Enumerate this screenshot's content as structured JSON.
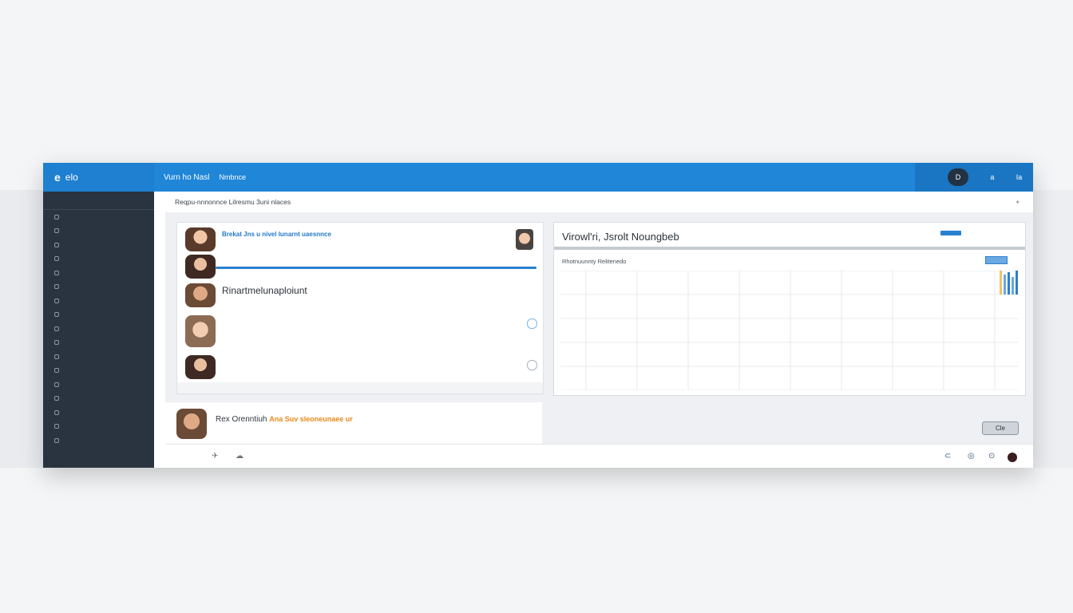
{
  "sidebar": {
    "logo": "e",
    "brand": "elo",
    "subnav": [
      "",
      ""
    ],
    "items": [
      {
        "label": "",
        "badge": ""
      },
      {
        "label": "",
        "badge": ""
      },
      {
        "label": "",
        "badge": ""
      },
      {
        "label": "",
        "badge": ""
      },
      {
        "label": "",
        "badge": ""
      },
      {
        "label": "",
        "badge": ""
      },
      {
        "label": "",
        "badge": ""
      },
      {
        "label": "",
        "badge": ""
      },
      {
        "label": "",
        "badge": ""
      },
      {
        "label": "",
        "badge": ""
      },
      {
        "label": "",
        "badge": ""
      },
      {
        "label": "",
        "badge": ""
      },
      {
        "label": "",
        "badge": ""
      },
      {
        "label": "",
        "badge": ""
      },
      {
        "label": "",
        "badge": ""
      },
      {
        "label": "",
        "badge": ""
      },
      {
        "label": "",
        "badge": ""
      }
    ]
  },
  "topbar": {
    "title": "Vurn ho Nasl",
    "subtitle": "Nmbnce",
    "center": "",
    "small": "",
    "right": [
      "",
      "D",
      "a",
      "Ia"
    ]
  },
  "subheader": {
    "text": "Reqpu-nnnonnce Lilresmu 3uni nlaces",
    "icon": "settings-icon"
  },
  "feed": {
    "rows": [
      {
        "title": "Brekat Jns u nivel lunarnt uaesnnce",
        "lines": [
          "",
          ""
        ]
      },
      {
        "head": "Rinartmelunaploiunt",
        "lines": [
          "",
          "",
          "",
          ""
        ]
      },
      {
        "lines": [
          "",
          ""
        ]
      }
    ],
    "progress": 1.0
  },
  "bottom_card": {
    "title": "Rex Orenntiuh",
    "accent": "Ana Suv sleoneunaee ur",
    "line": ""
  },
  "panel": {
    "title": "Virowl'ri, Jsrolt Noungbeb",
    "link": "",
    "sub": "Rhotnuunnty Relitenedo",
    "mid": "",
    "axis": [
      "",
      "",
      "",
      "",
      "",
      "",
      "",
      "",
      "",
      ""
    ]
  },
  "mini": {
    "line1": "",
    "line2": ""
  },
  "footer": {
    "tag1": "",
    "tag2": "",
    "close_label": "Cle"
  },
  "colors": {
    "topbar": "#1f86d8",
    "sidebar": "#2a3440",
    "accent": "#2a7fd0",
    "orange": "#e8891b"
  }
}
